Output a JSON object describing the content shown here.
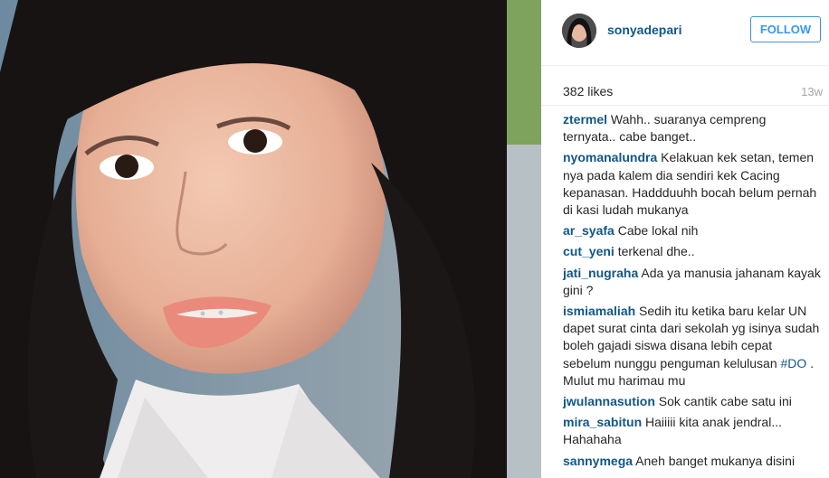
{
  "post": {
    "username": "sonyadepari",
    "follow_label": "FOLLOW",
    "likes": "382 likes",
    "age": "13w"
  },
  "comments": [
    {
      "user": "ztermel",
      "text": "Wahh.. suaranya cempreng ternyata.. cabe banget.."
    },
    {
      "user": "nyomanalundra",
      "text": "Kelakuan kek setan, temen nya pada kalem dia sendiri kek Cacing kepanasan. Haddduuhh bocah belum pernah di kasi ludah mukanya"
    },
    {
      "user": "ar_syafa",
      "text": "Cabe lokal nih"
    },
    {
      "user": "cut_yeni",
      "text": "terkenal dhe.."
    },
    {
      "user": "jati_nugraha",
      "text": "Ada ya manusia jahanam kayak gini ?"
    },
    {
      "user": "ismiamaliah",
      "text": "Sedih itu ketika baru kelar UN dapet surat cinta dari sekolah yg isinya sudah boleh gajadi siswa disana lebih cepat sebelum nunggu penguman kelulusan",
      "tag": "#DO",
      "text_after": ". Mulut mu harimau mu"
    },
    {
      "user": "jwulannasution",
      "text": "Sok cantik cabe satu ini"
    },
    {
      "user": "mira_sabitun",
      "text": "Haiiiii kita anak jendral... Hahahaha"
    },
    {
      "user": "sannymega",
      "text": "Aneh banget mukanya disini"
    }
  ],
  "icons": {
    "avatar": "profile-avatar",
    "photo": "post-photo"
  },
  "colors": {
    "username": "#125688",
    "follow": "#3897f0",
    "text": "#262626",
    "muted": "#a5a7aa"
  }
}
